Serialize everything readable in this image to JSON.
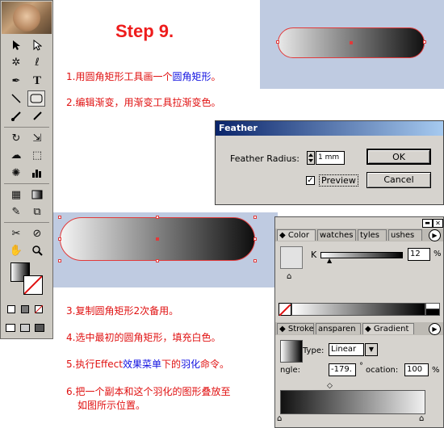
{
  "title": "Step 9.",
  "instructions": {
    "s1_pre": "1.用圆角矩形工具画一个",
    "s1_hl": "圆角矩形",
    "s1_post": "。",
    "s2": "2.编辑渐变，用渐变工具拉渐变色。",
    "s3": "3.复制圆角矩形2次备用。",
    "s4": "4.选中最初的圆角矩形，填充白色。",
    "s5_pre": "5.执行Effect",
    "s5_hl1": "效果菜单",
    "s5_mid": "下的",
    "s5_hl2": "羽化",
    "s5_post": "命令。",
    "s6_line1": "6.把一个副本和这个羽化的图形叠放至",
    "s6_line2": "如图所示位置。"
  },
  "feather_dialog": {
    "title": "Feather",
    "radius_label": "Feather Radius:",
    "radius_value": "1 mm",
    "preview_label": "Preview",
    "preview_checked": true,
    "ok_label": "OK",
    "cancel_label": "Cancel"
  },
  "color_panel": {
    "tabs": [
      "Color",
      "watches",
      "tyles",
      "ushes"
    ],
    "k_label": "K",
    "k_value": "12",
    "k_unit": "%",
    "k_level_percent": 12
  },
  "gradient_panel": {
    "tabs": [
      "Stroke",
      "ansparen",
      "Gradient"
    ],
    "type_label": "Type:",
    "type_value": "Linear",
    "angle_label": "ngle:",
    "angle_value": "-179.",
    "location_label": "ocation:",
    "location_value": "100",
    "location_unit": "%"
  },
  "colors": {
    "title_red": "#ee1c1c",
    "highlight_blue": "#1010e0",
    "panel_bg": "#bfcbe1"
  }
}
